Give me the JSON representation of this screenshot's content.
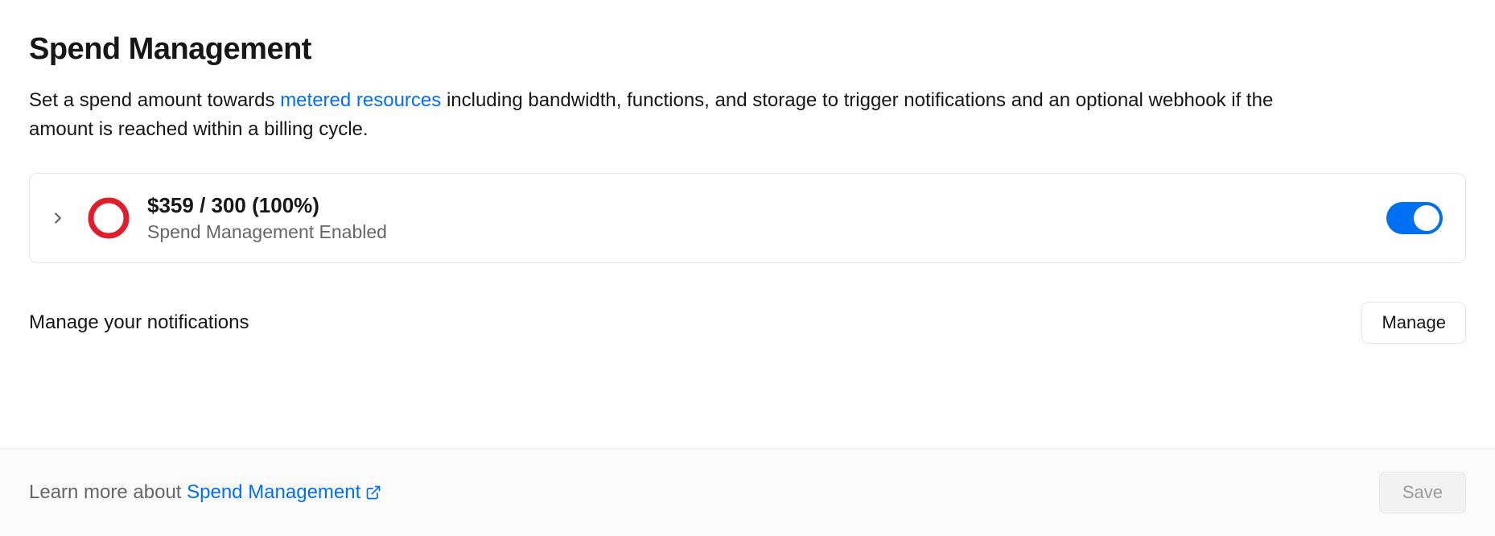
{
  "header": {
    "title": "Spend Management"
  },
  "description": {
    "prefix": "Set a spend amount towards ",
    "link": "metered resources",
    "suffix": " including bandwidth, functions, and storage to trigger notifications and an optional webhook if the amount is reached within a billing cycle."
  },
  "spend_card": {
    "amount_line": "$359 / 300 (100%)",
    "status_line": "Spend Management Enabled",
    "ring_color": "#e11d2a",
    "toggle_on": true
  },
  "notifications": {
    "label": "Manage your notifications",
    "button": "Manage"
  },
  "footer": {
    "prefix": "Learn more about ",
    "link": "Spend Management",
    "save": "Save"
  }
}
